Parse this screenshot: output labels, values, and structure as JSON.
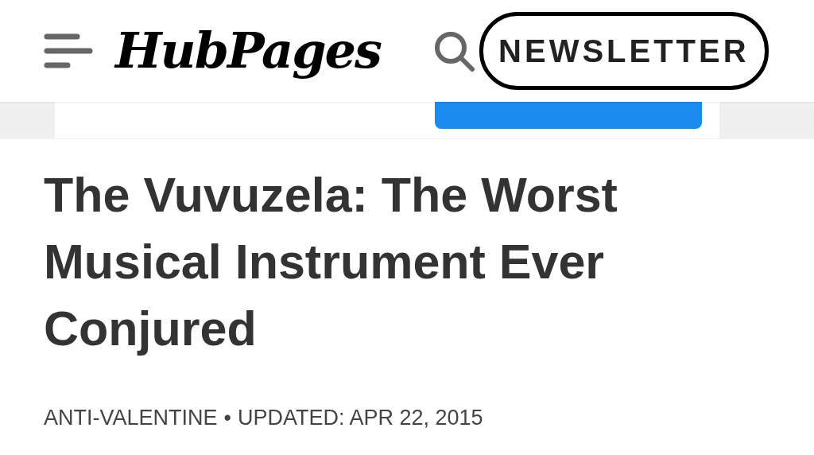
{
  "header": {
    "logo": "HubPages",
    "newsletter_button": "NEWSLETTER"
  },
  "article": {
    "title": "The Vuvuzela: The Worst Musical Instrument Ever Conjured",
    "category": "ANTI-VALENTINE",
    "separator": "•",
    "updated": "UPDATED: APR 22, 2015"
  }
}
